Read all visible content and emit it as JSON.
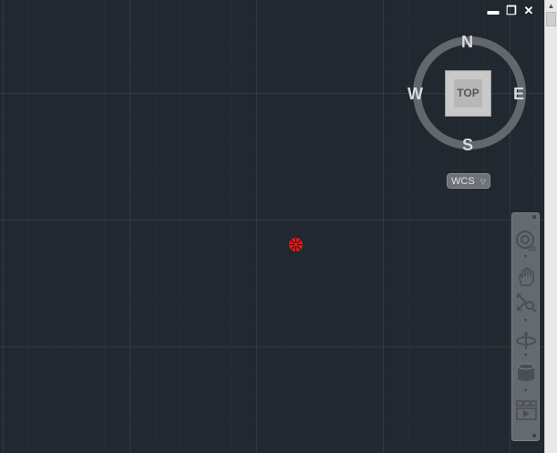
{
  "window_controls": {
    "minimize": "▬",
    "restore": "❐",
    "close": "✕"
  },
  "viewcube": {
    "compass": {
      "north": "N",
      "south": "S",
      "east": "E",
      "west": "W"
    },
    "face_label": "TOP"
  },
  "coordinate_system": {
    "label": "WCS",
    "dropdown_icon": "chevron-down-icon"
  },
  "navigation_bar": {
    "tools": [
      "steering-wheel-2d-icon",
      "pan-hand-icon",
      "zoom-extents-icon",
      "orbit-icon",
      "showmotion-icon",
      "view-grid-icon"
    ]
  },
  "colors": {
    "background": "#212830",
    "ucs_marker": "#e01919",
    "compass": "#6a6f76"
  }
}
